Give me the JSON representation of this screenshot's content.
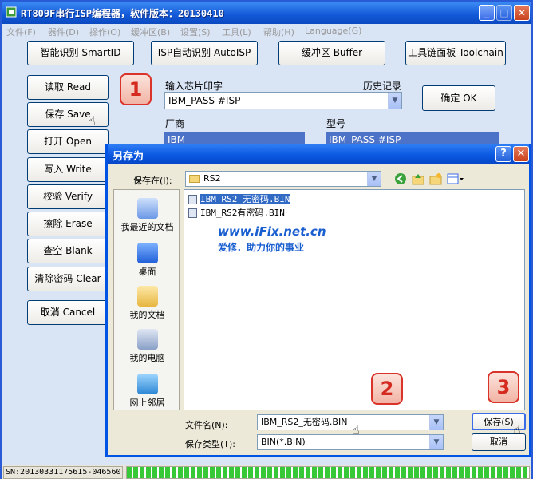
{
  "app": {
    "title": "RT809F串行ISP编程器，软件版本：20130410",
    "menu": [
      "文件(F)",
      "器件(D)",
      "操作(O)",
      "缓冲区(B)",
      "设置(S)",
      "工具(L)",
      "帮助(H)",
      "Language(G)"
    ]
  },
  "toolbar": {
    "smart_id": "智能识别 SmartID",
    "isp_auto": "ISP自动识别 AutoISP",
    "buffer": "缓冲区 Buffer",
    "toolchain": "工具链面板 Toolchain"
  },
  "side": {
    "read": "读取 Read",
    "save": "保存 Save",
    "open": "打开 Open",
    "write": "写入 Write",
    "verify": "校验 Verify",
    "erase": "擦除 Erase",
    "blank": "查空 Blank",
    "clear": "清除密码 Clear",
    "cancel": "取消 Cancel"
  },
  "chip": {
    "input_label": "输入芯片印字",
    "history_label": "历史记录",
    "input_value": "IBM_PASS #ISP",
    "confirm": "确定 OK",
    "vendor_label": "厂商",
    "model_label": "型号",
    "vendor_value": "IBM",
    "model_value": "IBM_PASS #ISP"
  },
  "dialog": {
    "title": "另存为",
    "save_in_label": "保存在(I):",
    "save_in_value": "RS2",
    "places": [
      "我最近的文档",
      "桌面",
      "我的文档",
      "我的电脑",
      "网上邻居"
    ],
    "files": [
      "IBM_RS2_无密码.BIN",
      "IBM_RS2有密码.BIN"
    ],
    "filename_label": "文件名(N):",
    "filename_value": "IBM_RS2_无密码.BIN",
    "filetype_label": "保存类型(T):",
    "filetype_value": "BIN(*.BIN)",
    "save_button": "保存(S)",
    "cancel_button": "取消"
  },
  "watermark": {
    "site": "www.iFix.net.cn",
    "slogan": "爱修．助力你的事业"
  },
  "callouts": [
    "1",
    "2",
    "3"
  ],
  "status": {
    "sn": "SN:20130331175615-046560"
  },
  "colors": {
    "titlebar": "#1259d8",
    "callout_red": "#d42a20",
    "progress_green": "#37c837"
  }
}
